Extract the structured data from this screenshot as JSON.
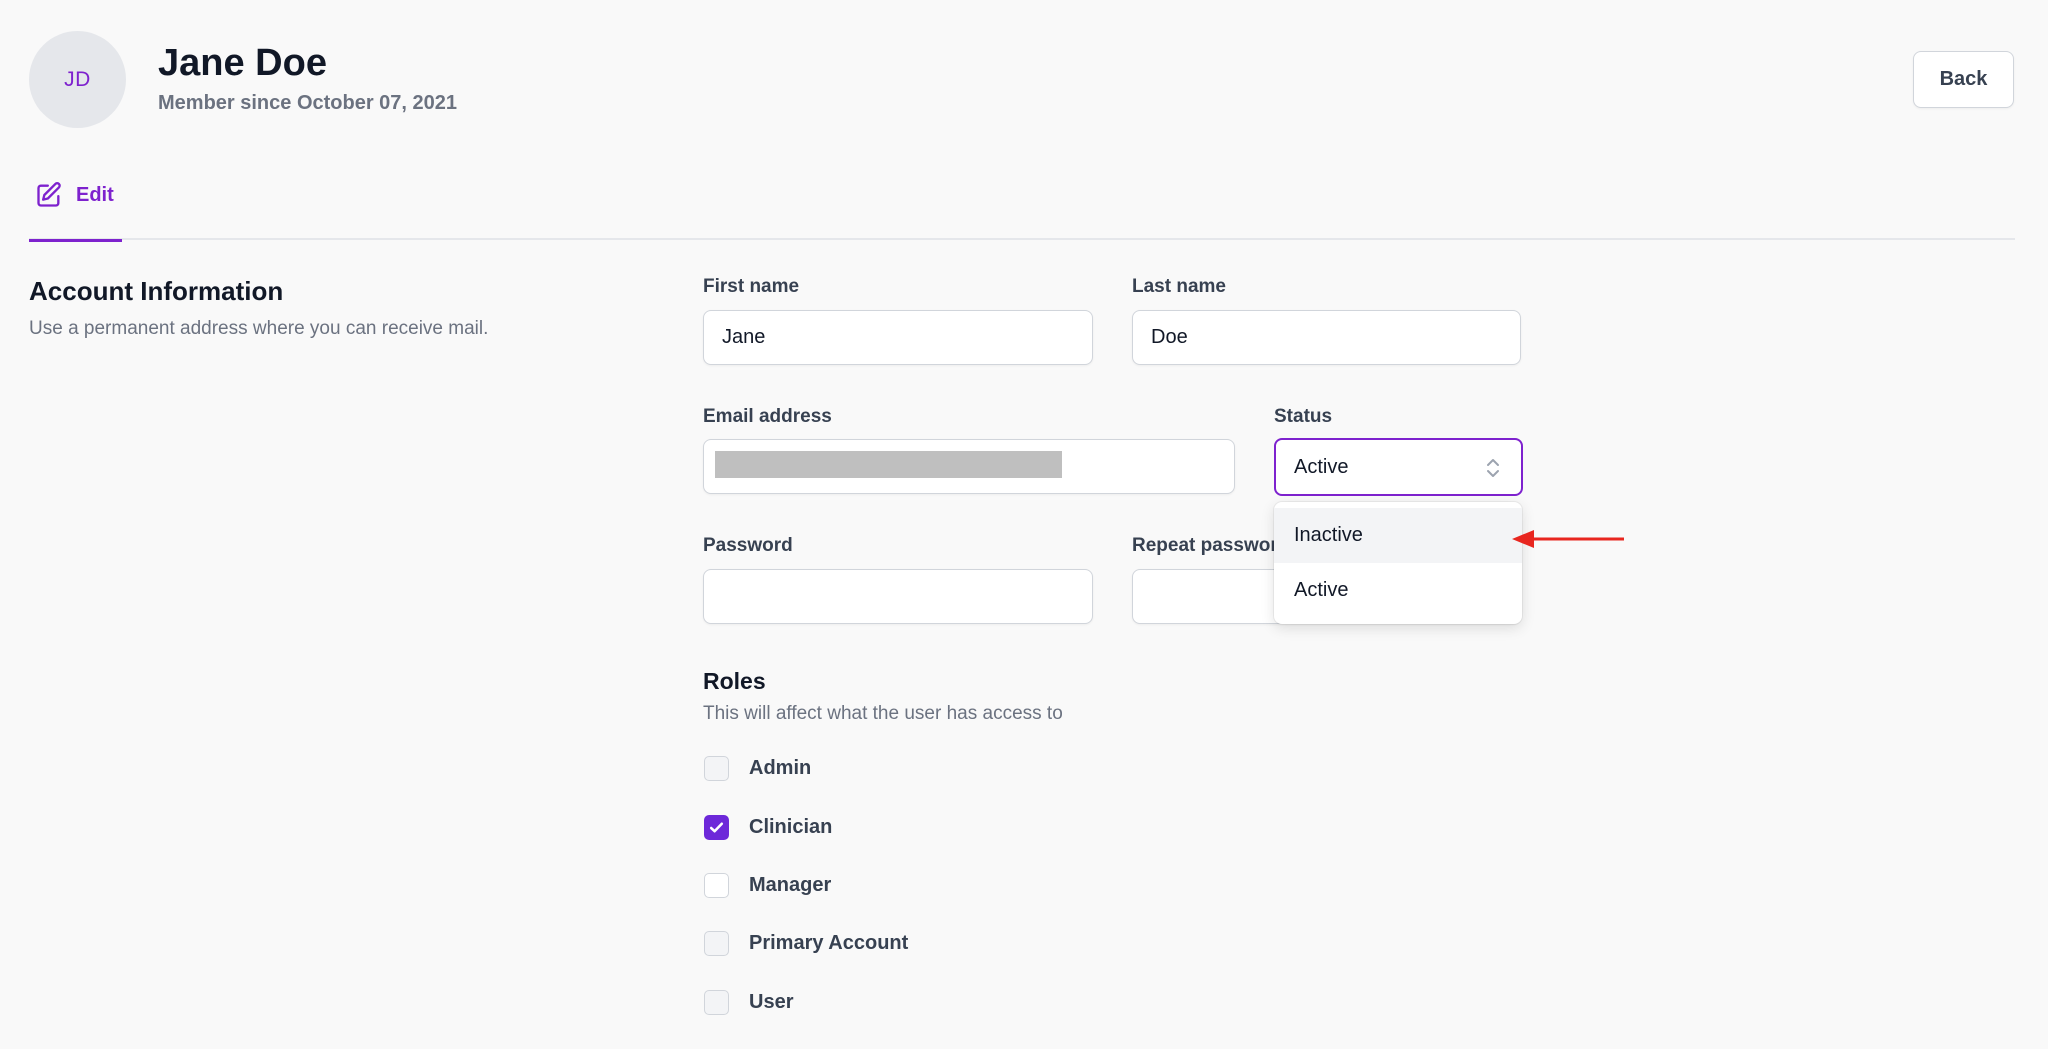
{
  "header": {
    "avatar_initials": "JD",
    "name": "Jane Doe",
    "member_since": "Member since October 07, 2021",
    "back_label": "Back"
  },
  "tabs": [
    {
      "label": "Edit",
      "icon": "pencil-square-icon",
      "active": true
    }
  ],
  "section": {
    "title": "Account Information",
    "description": "Use a permanent address where you can receive mail."
  },
  "form": {
    "first_name": {
      "label": "First name",
      "value": "Jane"
    },
    "last_name": {
      "label": "Last name",
      "value": "Doe"
    },
    "email": {
      "label": "Email address",
      "value": ""
    },
    "status": {
      "label": "Status",
      "value": "Active",
      "options": [
        "Inactive",
        "Active"
      ]
    },
    "password": {
      "label": "Password",
      "value": ""
    },
    "repeat_password": {
      "label": "Repeat password",
      "value": ""
    }
  },
  "roles": {
    "title": "Roles",
    "description": "This will affect what the user has access to",
    "items": [
      {
        "label": "Admin",
        "checked": false
      },
      {
        "label": "Clinician",
        "checked": true
      },
      {
        "label": "Manager",
        "checked": false
      },
      {
        "label": "Primary Account",
        "checked": false
      },
      {
        "label": "User",
        "checked": false
      }
    ]
  },
  "colors": {
    "accent": "#7e22ce",
    "checkbox_checked": "#6d28d9",
    "annotation_arrow": "#e8261f"
  }
}
